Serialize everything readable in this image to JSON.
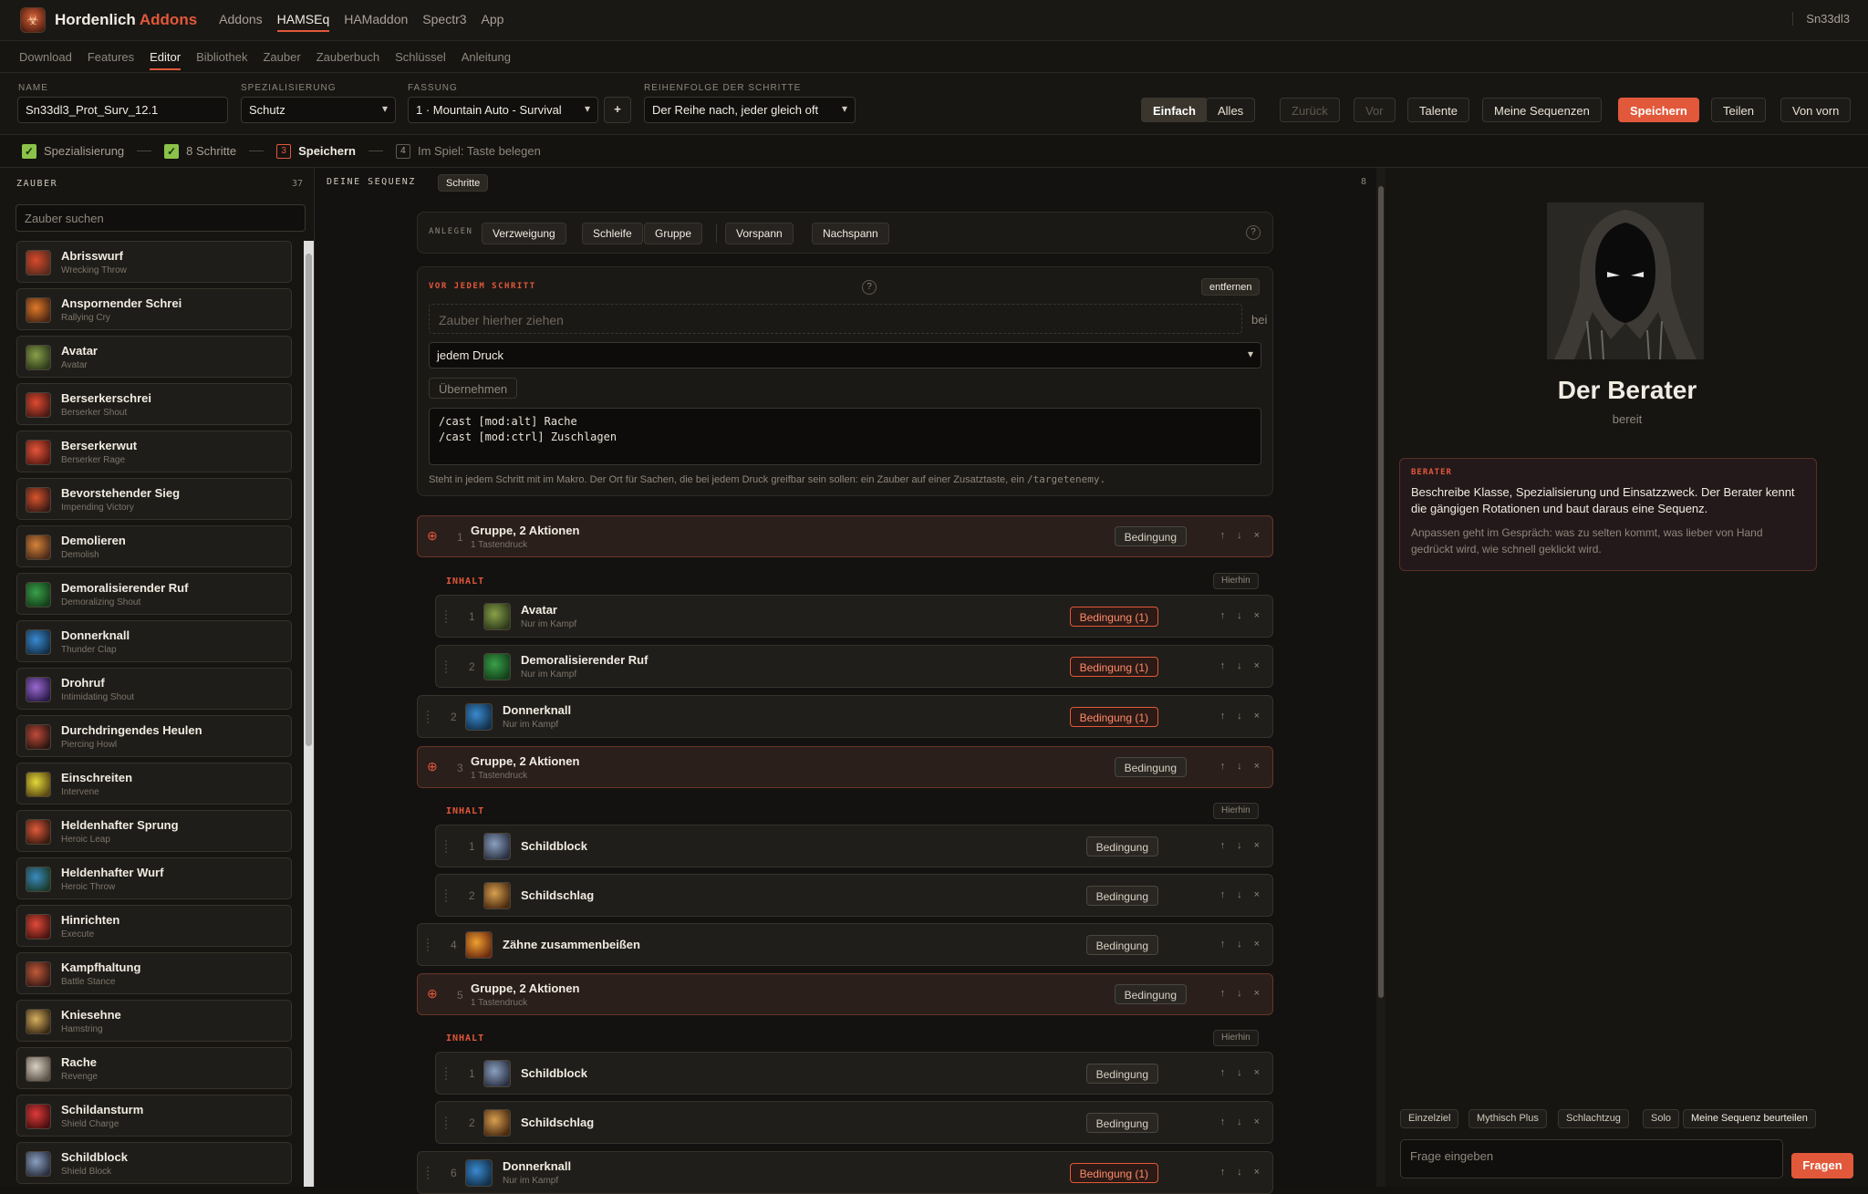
{
  "brand": {
    "name": "Hordenlich",
    "accent": "Addons"
  },
  "topnav": [
    "Addons",
    "HAMSEq",
    "HAMaddon",
    "Spectr3",
    "App"
  ],
  "user": "Sn33dl3",
  "subnav": [
    "Download",
    "Features",
    "Editor",
    "Bibliothek",
    "Zauber",
    "Zauberbuch",
    "Schlüssel",
    "Anleitung"
  ],
  "form": {
    "name_label": "NAME",
    "name_value": "Sn33dl3_Prot_Surv_12.1",
    "spec_label": "SPEZIALISIERUNG",
    "spec_value": "Schutz",
    "version_label": "FASSUNG",
    "version_value": "1 · Mountain Auto - Survival",
    "add": "+",
    "order_label": "REIHENFOLGE DER SCHRITTE",
    "order_value": "Der Reihe nach, jeder gleich oft"
  },
  "actions": {
    "simple": "Einfach",
    "all": "Alles",
    "back": "Zurück",
    "fwd": "Vor",
    "talents": "Talente",
    "mine": "Meine Sequenzen",
    "save": "Speichern",
    "share": "Teilen",
    "restart": "Von vorn"
  },
  "steps": {
    "s1": "Spezialisierung",
    "s2": "8 Schritte",
    "s3n": "3",
    "s3": "Speichern",
    "s4n": "4",
    "s4": "Im Spiel: Taste belegen"
  },
  "spells": {
    "header": "ZAUBER",
    "count": "37",
    "search_placeholder": "Zauber suchen",
    "items": [
      {
        "de": "Abrisswurf",
        "en": "Wrecking Throw"
      },
      {
        "de": "Anspornender Schrei",
        "en": "Rallying Cry"
      },
      {
        "de": "Avatar",
        "en": "Avatar"
      },
      {
        "de": "Berserkerschrei",
        "en": "Berserker Shout"
      },
      {
        "de": "Berserkerwut",
        "en": "Berserker Rage"
      },
      {
        "de": "Bevorstehender Sieg",
        "en": "Impending Victory"
      },
      {
        "de": "Demolieren",
        "en": "Demolish"
      },
      {
        "de": "Demoralisierender Ruf",
        "en": "Demoralizing Shout"
      },
      {
        "de": "Donnerknall",
        "en": "Thunder Clap"
      },
      {
        "de": "Drohruf",
        "en": "Intimidating Shout"
      },
      {
        "de": "Durchdringendes Heulen",
        "en": "Piercing Howl"
      },
      {
        "de": "Einschreiten",
        "en": "Intervene"
      },
      {
        "de": "Heldenhafter Sprung",
        "en": "Heroic Leap"
      },
      {
        "de": "Heldenhafter Wurf",
        "en": "Heroic Throw"
      },
      {
        "de": "Hinrichten",
        "en": "Execute"
      },
      {
        "de": "Kampfhaltung",
        "en": "Battle Stance"
      },
      {
        "de": "Kniesehne",
        "en": "Hamstring"
      },
      {
        "de": "Rache",
        "en": "Revenge"
      },
      {
        "de": "Schildansturm",
        "en": "Shield Charge"
      },
      {
        "de": "Schildblock",
        "en": "Shield Block"
      }
    ]
  },
  "sequence": {
    "header": "DEINE SEQUENZ",
    "tab": "Schritte",
    "count": "8",
    "create_label": "ANLEGEN",
    "tools": [
      "Verzweigung",
      "Schleife",
      "Gruppe",
      "Vorspann",
      "Nachspann"
    ],
    "pre": {
      "label": "VOR JEDEM SCHRITT",
      "remove": "entfernen",
      "drop_placeholder": "Zauber hierher ziehen",
      "bei": "bei",
      "trigger": "jedem Druck",
      "apply": "Übernehmen",
      "macro1": "/cast [mod:alt] Rache",
      "macro2": "/cast [mod:ctrl] Zuschlagen",
      "help": "Steht in jedem Schritt mit im Makro. Der Ort für Sachen, die bei jedem Druck greifbar sein sollen: ein Zauber auf einer Zusatztaste, ein",
      "help_code": "/targetenemy."
    },
    "inhalt": "INHALT",
    "hierhin": "Hierhin",
    "cond": "Bedingung",
    "cond1": "Bedingung (1)",
    "group_title": "Gruppe, 2 Aktionen",
    "group_sub": "1 Tastendruck",
    "in_combat": "Nur im Kampf",
    "n1": "1",
    "n2": "2",
    "n3": "3",
    "n4": "4",
    "n5": "5",
    "n6": "6",
    "avatar": "Avatar",
    "demo": "Demoralisierender Ruf",
    "thunder": "Donnerknall",
    "block": "Schildblock",
    "slam": "Schildschlag",
    "teeth": "Zähne zusammenbeißen"
  },
  "advisor": {
    "name": "Der Berater",
    "status": "bereit",
    "bubble_label": "BERATER",
    "bubble_main": "Beschreibe Klasse, Spezialisierung und Einsatzzweck. Der Berater kennt die gängigen Rotationen und baut daraus eine Sequenz.",
    "bubble_sub": "Anpassen geht im Gespräch: was zu selten kommt, was lieber von Hand gedrückt wird, wie schnell geklickt wird.",
    "chips": [
      "Einzelziel",
      "Mythisch Plus",
      "Schlachtzug",
      "Solo",
      "Meine Sequenz beurteilen"
    ],
    "ask_placeholder": "Frage eingeben",
    "ask_button": "Fragen"
  },
  "colors": {
    "accent": "#e2583a",
    "ok": "#8bc34a",
    "bg": "#141310"
  }
}
